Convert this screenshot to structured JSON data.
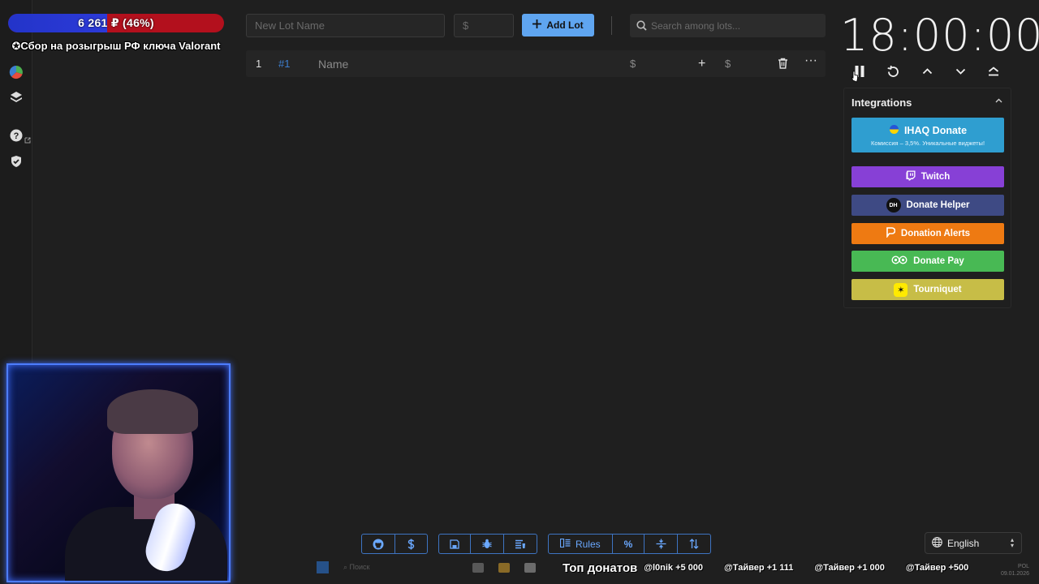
{
  "overlay": {
    "progress_text": "6 261 ₽ (46%)",
    "progress_fraction": 0.46,
    "goal_text": "✪Сбор на розыгрыш РФ ключа Valorant"
  },
  "toolbar": {
    "lot_name_placeholder": "New Lot Name",
    "amount_placeholder": "$",
    "add_lot_label": "Add Lot",
    "search_placeholder": "Search among lots..."
  },
  "lot": {
    "index": "1",
    "id": "#1",
    "name": "Name",
    "amount_symbol": "$",
    "add_symbol": "+",
    "add_amount_symbol": "$",
    "more": "···"
  },
  "timer": {
    "value": "18:00:00"
  },
  "integrations": {
    "title": "Integrations",
    "ihaq_label": "IHAQ Donate",
    "ihaq_sub": "Комиссия – 3,5%. Уникальные виджеты!",
    "twitch_label": "Twitch",
    "donate_helper_label": "Donate Helper",
    "donate_helper_badge": "DH",
    "donation_alerts_label": "Donation Alerts",
    "donate_pay_label": "Donate Pay",
    "tourniquet_label": "Tourniquet",
    "colors": {
      "ihaq": "#2f9ed0",
      "twitch": "#8740d6",
      "donate_helper": "#3e4a84",
      "donation_alerts": "#ee7a12",
      "donate_pay": "#48b954",
      "tourniquet": "#c7bd47"
    }
  },
  "bottom_toolbar": {
    "rules_label": "Rules",
    "percent_label": "%"
  },
  "language": {
    "selected": "English"
  },
  "ticker": {
    "title": "Топ донатов",
    "items": [
      "@l0nik +5 000",
      "@Тайвер +1 111",
      "@Тайвер +1 000",
      "@Тайвер +500"
    ]
  },
  "taskbar": {
    "search_placeholder": "Поиск",
    "lang": "POL",
    "date": "09.01.2026"
  }
}
